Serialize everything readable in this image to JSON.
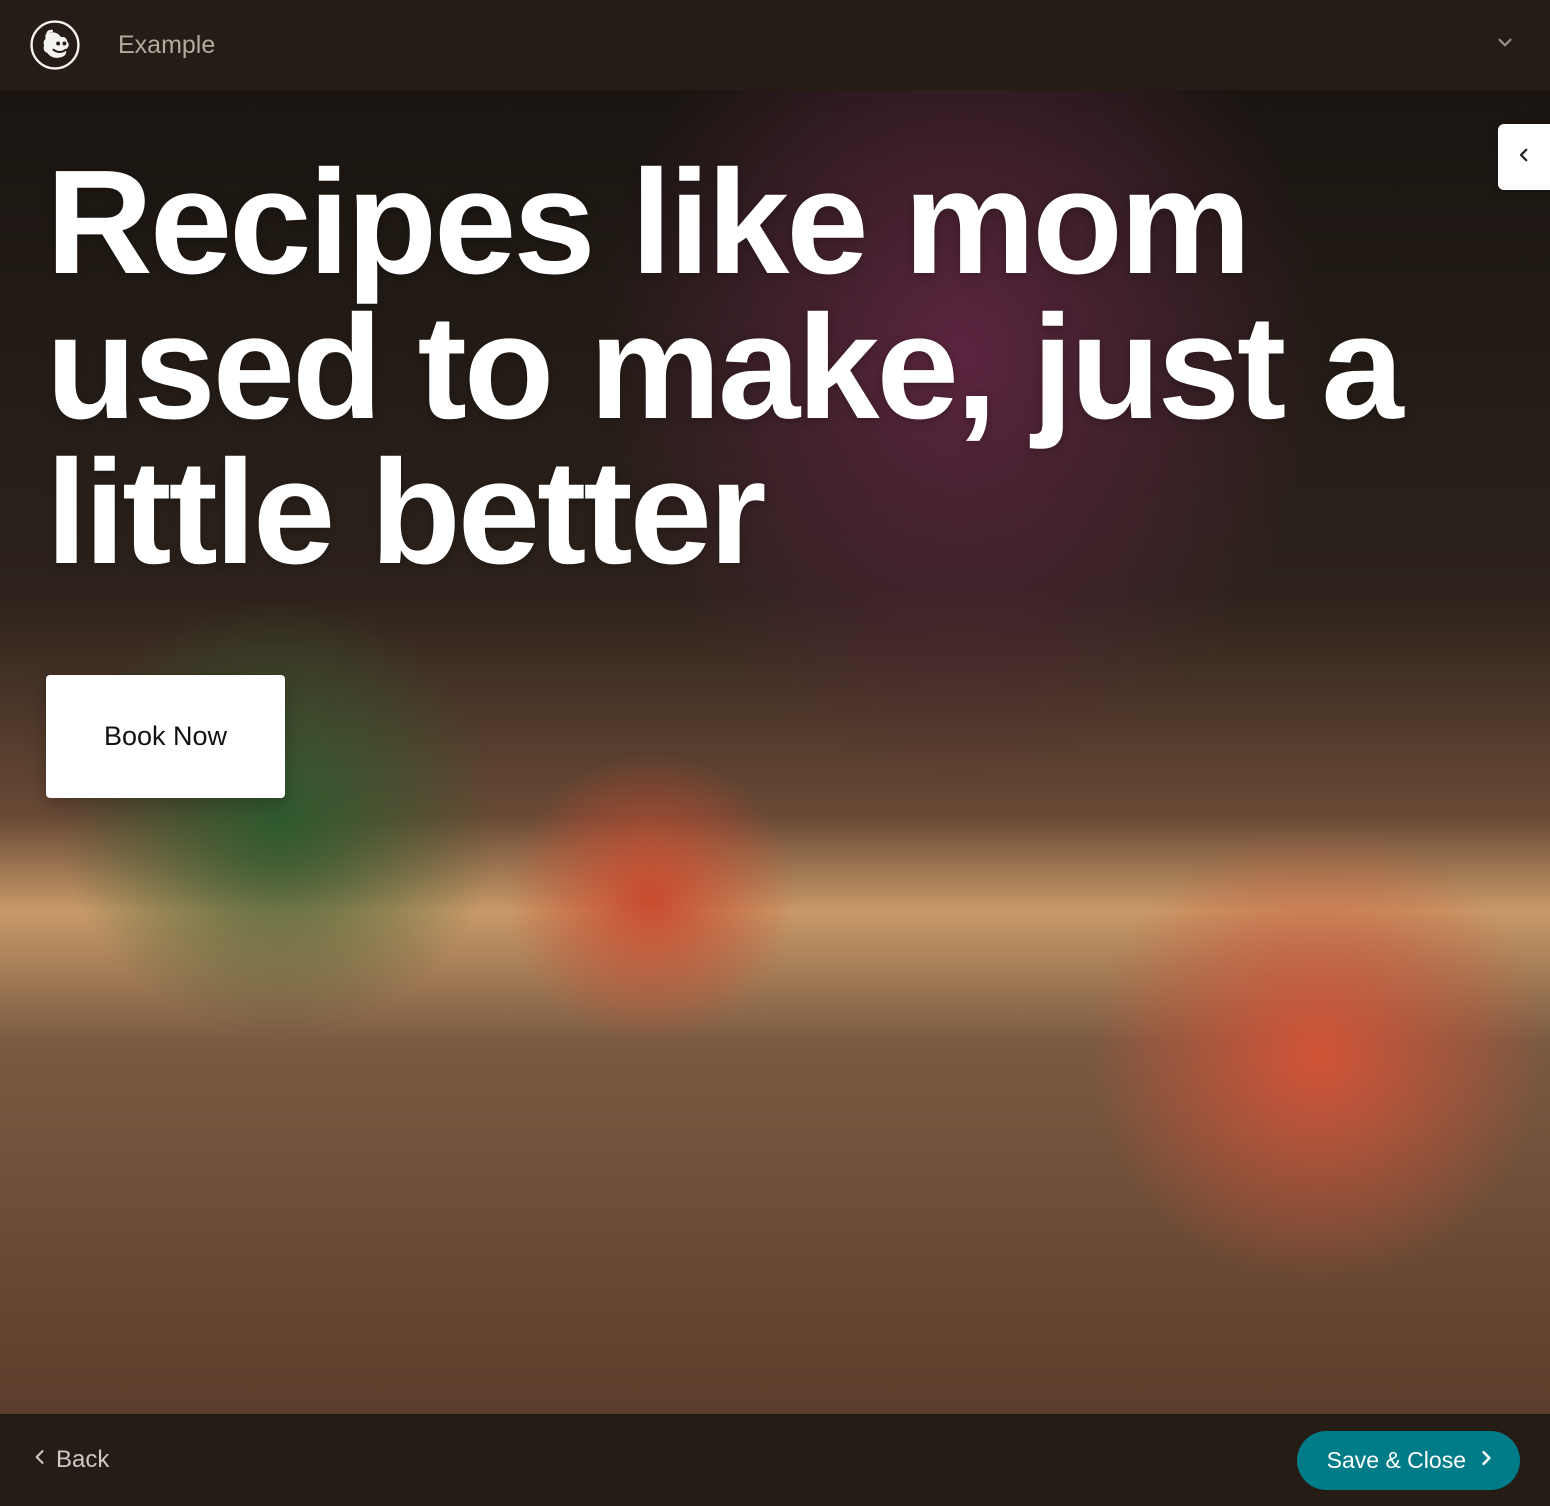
{
  "header": {
    "project_name": "Example"
  },
  "hero": {
    "title": "Recipes like mom used to make, just a little better",
    "cta_label": "Book Now"
  },
  "footer": {
    "back_label": "Back",
    "save_label": "Save & Close"
  },
  "colors": {
    "top_bar_bg": "#241c15",
    "save_button_bg": "#007c89"
  }
}
